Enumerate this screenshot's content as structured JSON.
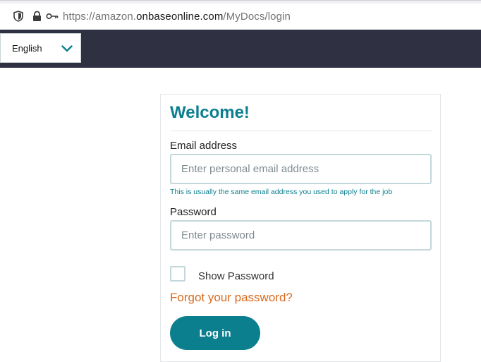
{
  "browser": {
    "url_prefix": "https://amazon.",
    "url_domain": "onbaseonline.com",
    "url_path": "/MyDocs/login"
  },
  "header": {
    "language": {
      "selected": "English",
      "icon": "chevron-down-icon"
    }
  },
  "login": {
    "title": "Welcome!",
    "email_label": "Email address",
    "email_placeholder": "Enter personal email address",
    "email_value": "",
    "email_helper": "This is usually the same email address you used to apply for the job",
    "password_label": "Password",
    "password_placeholder": "Enter password",
    "password_value": "",
    "show_password_label": "Show Password",
    "show_password_checked": false,
    "forgot_link": "Forgot your password?",
    "submit_label": "Log in"
  },
  "colors": {
    "accent": "#0c7f8f",
    "header_bg": "#2f3041",
    "link_orange": "#d96b1f",
    "input_border": "#c4d7db"
  }
}
